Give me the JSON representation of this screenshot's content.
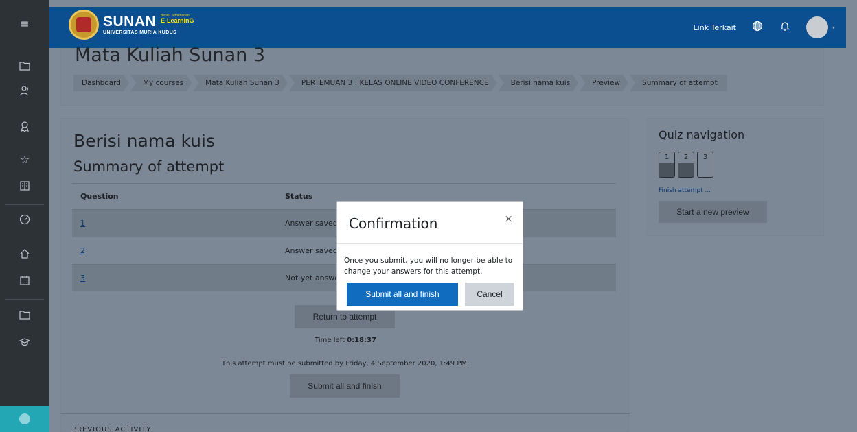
{
  "header": {
    "brand_name": "SUNAN",
    "brand_tag": "Bimau Temenanan",
    "brand_sub": "E-LearninG",
    "university": "UNIVERSITAS MURIA KUDUS",
    "link_label": "Link Terkait",
    "language_icon": "globe-icon",
    "notification_icon": "bell-icon"
  },
  "sidebar": {
    "icons": [
      "menu-icon",
      "folder-icon",
      "users-icon",
      "badge-icon",
      "star-icon",
      "book-icon",
      "dashboard-icon",
      "home-icon",
      "calendar-icon",
      "folder-icon",
      "graduation-cap-icon",
      "accessibility-icon"
    ]
  },
  "course_title": "Mata Kuliah Sunan 3",
  "breadcrumb": [
    "Dashboard",
    "My courses",
    "Mata Kuliah Sunan 3",
    "PERTEMUAN 3 : KELAS ONLINE VIDEO CONFERENCE",
    "Berisi nama kuis",
    "Preview",
    "Summary of attempt"
  ],
  "main": {
    "quiz_title": "Berisi nama kuis",
    "summary_title": "Summary of attempt",
    "table": {
      "headers": [
        "Question",
        "Status"
      ],
      "rows": [
        {
          "q": "1",
          "status": "Answer saved"
        },
        {
          "q": "2",
          "status": "Answer saved"
        },
        {
          "q": "3",
          "status": "Not yet answered"
        }
      ]
    },
    "return_label": "Return to attempt",
    "time_left_label": "Time left",
    "time_left_value": "0:18:37",
    "deadline_note": "This attempt must be submitted by Friday, 4 September 2020, 1:49 PM.",
    "submit_label": "Submit all and finish",
    "previous_activity": "PREVIOUS ACTIVITY"
  },
  "quiz_nav": {
    "title": "Quiz navigation",
    "questions": [
      "1",
      "2",
      "3"
    ],
    "finish_link": "Finish attempt ...",
    "new_preview": "Start a new preview"
  },
  "modal": {
    "title": "Confirmation",
    "close": "×",
    "body": "Once you submit, you will no longer be able to change your answers for this attempt.",
    "confirm_label": "Submit all and finish",
    "cancel_label": "Cancel"
  },
  "colors": {
    "topbar": "#0b4f91",
    "primary_button": "#0f6cbf",
    "rail": "#2d3237",
    "accessibility": "#23a7b5"
  }
}
